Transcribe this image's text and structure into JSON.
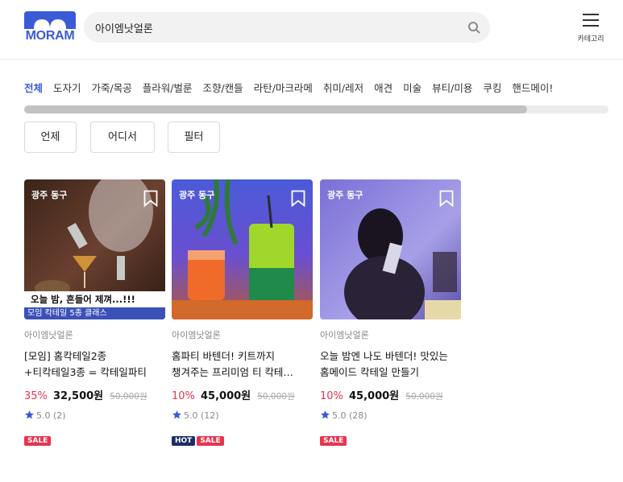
{
  "header": {
    "logo_text": "MORAM",
    "search_query": "아이엠낫얼론",
    "menu_label": "카테고리"
  },
  "tabs": [
    "전체",
    "도자기",
    "가죽/목공",
    "플라워/벌룬",
    "조향/캔들",
    "라탄/마크라메",
    "취미/레저",
    "애견",
    "미술",
    "뷰티/미용",
    "쿠킹",
    "핸드메이!"
  ],
  "filters": [
    "언제",
    "어디서",
    "필터"
  ],
  "colors": {
    "accent": "#3b5bd6",
    "discount": "#e8344e",
    "hot_badge": "#1d2d66"
  },
  "cards": [
    {
      "location": "광주 동구",
      "vendor": "아이엠낫얼론",
      "title_line1": "[모임] 홈칵테일2종",
      "title_line2": "+티칵테일3종 = 칵테일파티",
      "discount": "35%",
      "price": "32,500원",
      "original_price": "50,000원",
      "rating": "5.0",
      "reviews": "(2)",
      "overlay_text": "오늘 밤, 흔들어 제껴...!!!",
      "overlay_sub": "모임 칵테일 5종 클래스",
      "badges": [
        "SALE"
      ]
    },
    {
      "location": "광주 동구",
      "vendor": "아이엠낫얼론",
      "title_line1": "홈파티 바텐더! 키트까지",
      "title_line2": "챙겨주는 프리미엄 티 칵테…",
      "discount": "10%",
      "price": "45,000원",
      "original_price": "50,000원",
      "rating": "5.0",
      "reviews": "(12)",
      "badges": [
        "HOT",
        "SALE"
      ]
    },
    {
      "location": "광주 동구",
      "vendor": "아이엠낫얼론",
      "title_line1": "오늘 밤엔 나도 바텐더! 맛있는",
      "title_line2": "홈메이드 칵테일 만들기",
      "discount": "10%",
      "price": "45,000원",
      "original_price": "50,000원",
      "rating": "5.0",
      "reviews": "(28)",
      "badges": [
        "SALE"
      ]
    }
  ]
}
